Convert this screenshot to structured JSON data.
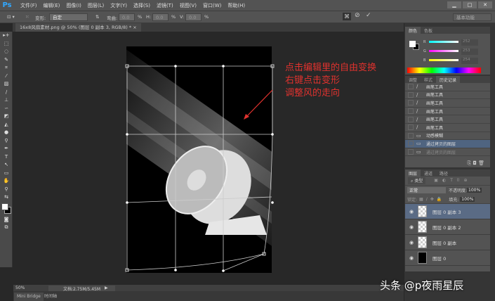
{
  "app": {
    "logo": "Ps",
    "menus": [
      "文件(F)",
      "编辑(E)",
      "图像(I)",
      "图层(L)",
      "文字(Y)",
      "选择(S)",
      "滤镜(T)",
      "视图(V)",
      "窗口(W)",
      "帮助(H)"
    ],
    "window_controls": [
      "▁",
      "□",
      "✕"
    ]
  },
  "options": {
    "warp_label": "变形:",
    "warp_value": "自定",
    "bend_label": "弯曲:",
    "bend_value": "0.0",
    "h_label": "H:",
    "h_value": "0.0",
    "v_label": "V:",
    "v_value": "0.0",
    "pct": "%",
    "workspace": "基本功能"
  },
  "document": {
    "tab": "16x8风扇素材.png @ 50% (图层 0 副本 3, RGB/8) *",
    "close": "×"
  },
  "annotation": [
    "点击编辑里的自由变换",
    "右键点击变形",
    "调整风的走向"
  ],
  "status": {
    "zoom": "50%",
    "doc_info": "文档:2.75M/5.45M"
  },
  "bottom_tabs": [
    "Mini Bridge",
    "时间轴"
  ],
  "color_panel": {
    "tabs": [
      "颜色",
      "色板"
    ],
    "r": "252",
    "g": "253",
    "b": "254",
    "labels": [
      "R",
      "G",
      "B"
    ]
  },
  "history_panel": {
    "tabs": [
      "调整",
      "样式",
      "历史记录"
    ],
    "items": [
      {
        "label": "画笔工具",
        "icon": "brush"
      },
      {
        "label": "画笔工具",
        "icon": "brush"
      },
      {
        "label": "画笔工具",
        "icon": "brush"
      },
      {
        "label": "画笔工具",
        "icon": "brush"
      },
      {
        "label": "画笔工具",
        "icon": "brush"
      },
      {
        "label": "画笔工具",
        "icon": "brush"
      },
      {
        "label": "动感模糊",
        "icon": "doc"
      },
      {
        "label": "通过拷贝的图层",
        "icon": "doc",
        "selected": true
      },
      {
        "label": "通过拷贝的图层",
        "icon": "doc",
        "dimmed": true
      }
    ]
  },
  "layers_panel": {
    "tabs": [
      "图层",
      "通道",
      "路径"
    ],
    "filter": "类型",
    "blend": "正常",
    "opacity_label": "不透明度:",
    "opacity": "100%",
    "lock_label": "锁定:",
    "fill_label": "填充:",
    "fill": "100%",
    "layers": [
      {
        "name": "图层 0 副本 3",
        "selected": true
      },
      {
        "name": "图层 0 副本 2"
      },
      {
        "name": "图层 0 副本"
      },
      {
        "name": "图层 0",
        "black": true
      }
    ]
  },
  "watermark": "头条 @p夜雨星辰",
  "colors": {
    "annotation": "#e0322e",
    "selection": "#4f6480"
  }
}
